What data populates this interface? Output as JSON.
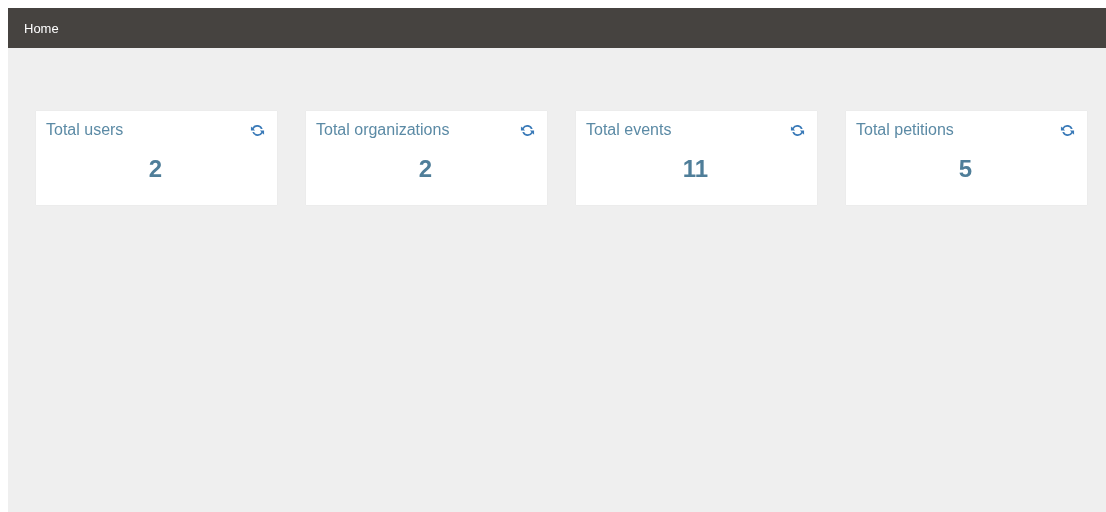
{
  "navbar": {
    "title": "Home"
  },
  "cards": [
    {
      "label": "Total users",
      "value": "2"
    },
    {
      "label": "Total organizations",
      "value": "2"
    },
    {
      "label": "Total events",
      "value": "11"
    },
    {
      "label": "Total petitions",
      "value": "5"
    }
  ]
}
